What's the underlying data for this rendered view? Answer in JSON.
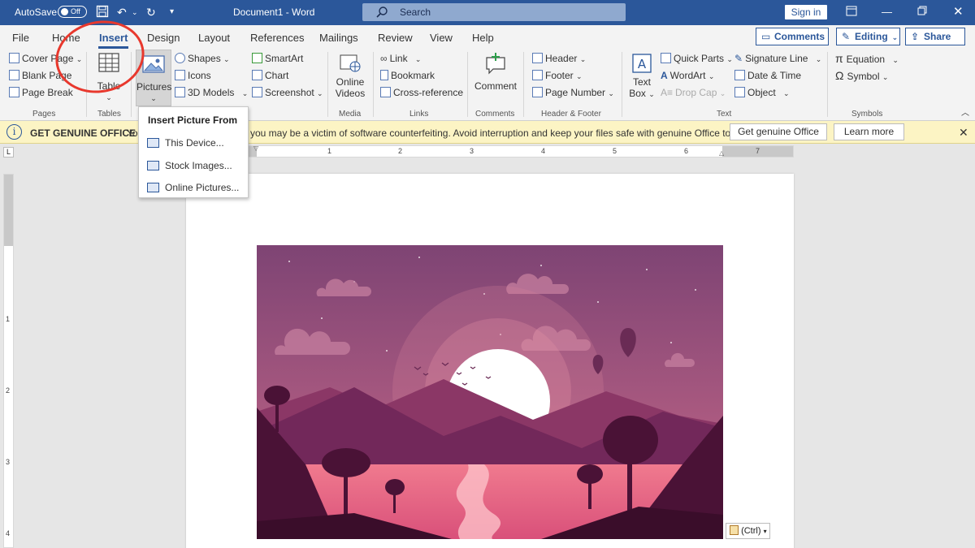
{
  "titlebar": {
    "autosave_label": "AutoSave",
    "autosave_state": "Off",
    "doc_title": "Document1 - Word",
    "search_placeholder": "Search",
    "signin_label": "Sign in",
    "accent": "#2b579a"
  },
  "tabs": [
    "File",
    "Home",
    "Insert",
    "Design",
    "Layout",
    "References",
    "Mailings",
    "Review",
    "View",
    "Help"
  ],
  "active_tab": "Insert",
  "top_buttons": {
    "comments": "Comments",
    "editing": "Editing",
    "share": "Share"
  },
  "ribbon": {
    "pages": {
      "items": [
        "Cover Page",
        "Blank Page",
        "Page Break"
      ],
      "label": "Pages"
    },
    "tables": {
      "button": "Table",
      "label": "Tables"
    },
    "illustrations": {
      "pictures": "Pictures",
      "items": [
        "Shapes",
        "Icons",
        "3D Models",
        "SmartArt",
        "Chart",
        "Screenshot"
      ]
    },
    "media": {
      "button_line1": "Online",
      "button_line2": "Videos",
      "label": "Media"
    },
    "links": {
      "items": [
        "Link",
        "Bookmark",
        "Cross-reference"
      ],
      "label": "Links"
    },
    "comments": {
      "button": "Comment",
      "label": "Comments"
    },
    "header_footer": {
      "items": [
        "Header",
        "Footer",
        "Page Number"
      ],
      "label": "Header & Footer"
    },
    "text": {
      "textbox_line1": "Text",
      "textbox_line2": "Box",
      "items": [
        "Quick Parts",
        "WordArt",
        "Drop Cap",
        "Signature Line",
        "Date & Time",
        "Object"
      ],
      "label": "Text"
    },
    "symbols": {
      "items": [
        "Equation",
        "Symbol"
      ],
      "label": "Symbols"
    }
  },
  "dropdown": {
    "header": "Insert Picture From",
    "items": [
      "This Device...",
      "Stock Images...",
      "Online Pictures..."
    ]
  },
  "message_bar": {
    "heading": "GET GENUINE OFFICE",
    "lead": "Yo",
    "message": "you may be a victim of software counterfeiting. Avoid interruption and keep your files safe with genuine Office today.",
    "button_primary": "Get genuine Office",
    "button_secondary": "Learn more",
    "background": "#fcf4c4"
  },
  "ruler_numbers": [
    "1",
    "2",
    "3",
    "4",
    "5",
    "6",
    "7"
  ],
  "vruler_numbers": [
    "1",
    "2",
    "3",
    "4"
  ],
  "paste_tag": "(Ctrl)",
  "annotation_color": "#e8382d"
}
